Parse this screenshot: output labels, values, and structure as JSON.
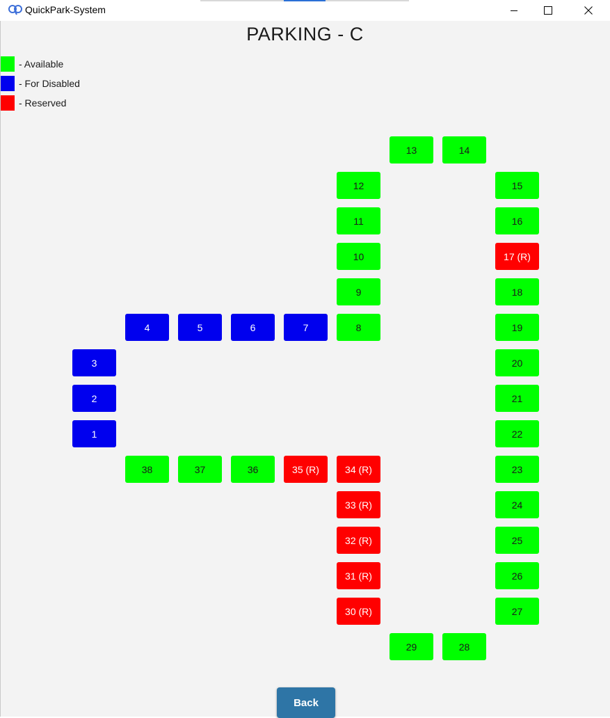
{
  "window": {
    "title": "QuickPark-System",
    "app_icon": "quickpark-logo-icon",
    "controls": [
      {
        "name": "minimize-button",
        "icon": "minimize-icon"
      },
      {
        "name": "maximize-button",
        "icon": "maximize-icon"
      },
      {
        "name": "close-button",
        "icon": "close-icon"
      }
    ]
  },
  "page": {
    "title": "PARKING - C"
  },
  "colors": {
    "available": "#00ff00",
    "disabled": "#0000ee",
    "reserved": "#ff0000",
    "accent": "#2e75a6",
    "background": "#f3f3f3"
  },
  "legend": [
    {
      "status": "available",
      "label": "- Available"
    },
    {
      "status": "disabled",
      "label": "- For Disabled"
    },
    {
      "status": "reserved",
      "label": "- Reserved"
    }
  ],
  "slots": [
    {
      "id": 1,
      "label": "1",
      "status": "disabled"
    },
    {
      "id": 2,
      "label": "2",
      "status": "disabled"
    },
    {
      "id": 3,
      "label": "3",
      "status": "disabled"
    },
    {
      "id": 4,
      "label": "4",
      "status": "disabled"
    },
    {
      "id": 5,
      "label": "5",
      "status": "disabled"
    },
    {
      "id": 6,
      "label": "6",
      "status": "disabled"
    },
    {
      "id": 7,
      "label": "7",
      "status": "disabled"
    },
    {
      "id": 8,
      "label": "8",
      "status": "available"
    },
    {
      "id": 9,
      "label": "9",
      "status": "available"
    },
    {
      "id": 10,
      "label": "10",
      "status": "available"
    },
    {
      "id": 11,
      "label": "11",
      "status": "available"
    },
    {
      "id": 12,
      "label": "12",
      "status": "available"
    },
    {
      "id": 13,
      "label": "13",
      "status": "available"
    },
    {
      "id": 14,
      "label": "14",
      "status": "available"
    },
    {
      "id": 15,
      "label": "15",
      "status": "available"
    },
    {
      "id": 16,
      "label": "16",
      "status": "available"
    },
    {
      "id": 17,
      "label": "17 (R)",
      "status": "reserved"
    },
    {
      "id": 18,
      "label": "18",
      "status": "available"
    },
    {
      "id": 19,
      "label": "19",
      "status": "available"
    },
    {
      "id": 20,
      "label": "20",
      "status": "available"
    },
    {
      "id": 21,
      "label": "21",
      "status": "available"
    },
    {
      "id": 22,
      "label": "22",
      "status": "available"
    },
    {
      "id": 23,
      "label": "23",
      "status": "available"
    },
    {
      "id": 24,
      "label": "24",
      "status": "available"
    },
    {
      "id": 25,
      "label": "25",
      "status": "available"
    },
    {
      "id": 26,
      "label": "26",
      "status": "available"
    },
    {
      "id": 27,
      "label": "27",
      "status": "available"
    },
    {
      "id": 28,
      "label": "28",
      "status": "available"
    },
    {
      "id": 29,
      "label": "29",
      "status": "available"
    },
    {
      "id": 30,
      "label": "30 (R)",
      "status": "reserved"
    },
    {
      "id": 31,
      "label": "31 (R)",
      "status": "reserved"
    },
    {
      "id": 32,
      "label": "32 (R)",
      "status": "reserved"
    },
    {
      "id": 33,
      "label": "33 (R)",
      "status": "reserved"
    },
    {
      "id": 34,
      "label": "34 (R)",
      "status": "reserved"
    },
    {
      "id": 35,
      "label": "35 (R)",
      "status": "reserved"
    },
    {
      "id": 36,
      "label": "36",
      "status": "available"
    },
    {
      "id": 37,
      "label": "37",
      "status": "available"
    },
    {
      "id": 38,
      "label": "38",
      "status": "available"
    }
  ],
  "back_button": {
    "label": "Back"
  }
}
